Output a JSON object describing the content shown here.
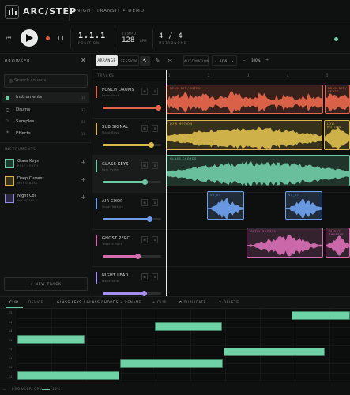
{
  "app": {
    "name": "ARC/STEP",
    "project": "NIGHT TRANSIT • DEMO"
  },
  "transport": {
    "position": "1.1.1",
    "position_label": "POSITION",
    "tempo_label": "TEMPO",
    "tempo": "128",
    "tempo_unit": "BPM",
    "meter": "4 / 4",
    "meter_label": "METRONOME"
  },
  "browser": {
    "title": "BROWSER",
    "search_placeholder": "Search sounds",
    "categories": [
      {
        "label": "Instruments",
        "count": "10",
        "color": "#6ec7a2"
      },
      {
        "label": "Drums",
        "count": "32",
        "color": "#4a4d4c"
      },
      {
        "label": "Samples",
        "count": "88",
        "color": "#4a4d4c"
      },
      {
        "label": "Effects",
        "count": "18",
        "color": "#4a4d4c"
      }
    ],
    "section": "INSTRUMENTS",
    "instruments": [
      {
        "name": "Glass Keys",
        "sub": "POLY SYNTH",
        "color": "#6ec7a2"
      },
      {
        "name": "Deep Current",
        "sub": "MONO BASS",
        "color": "#d6b64a"
      },
      {
        "name": "Night Coil",
        "sub": "WAVETABLE",
        "color": "#8f8be0"
      }
    ],
    "new_track": "+ NEW TRACK"
  },
  "toolbar": {
    "arrange": "ARRANGE",
    "session": "SESSION",
    "automation": "AUTOMATION",
    "grid": "1/16",
    "zoom": "100%"
  },
  "tracks_header": "TRACKS",
  "ruler": [
    "1",
    "2",
    "3",
    "4",
    "5"
  ],
  "tracks": [
    {
      "name": "PUNCH DRUMS",
      "sub": "Drum Rack",
      "color": "#e0654a",
      "volume": 0.95,
      "clips": [
        {
          "label": "NEON KIT / INTRO"
        },
        {
          "label": "NEON KIT / VERSE"
        }
      ]
    },
    {
      "name": "SUB SIGNAL",
      "sub": "Mono Bass",
      "color": "#d8b84c",
      "volume": 0.82,
      "clips": [
        {
          "label": "LOW MOTION"
        },
        {
          "label": "LOW MOTION"
        }
      ]
    },
    {
      "name": "GLASS KEYS",
      "sub": "Poly Synth",
      "color": "#6ec7a2",
      "volume": 0.72,
      "clips": [
        {
          "label": "GLASS CHORDS"
        }
      ]
    },
    {
      "name": "AIR CHOP",
      "sub": "Vocal Texture",
      "color": "#6c9eea",
      "volume": 0.8,
      "clips": [
        {
          "label": "VX_04"
        },
        {
          "label": "VX_07"
        }
      ]
    },
    {
      "name": "GHOST PERC",
      "sub": "Texture Rack",
      "color": "#d36db0",
      "volume": 0.6,
      "clips": [
        {
          "label": "METAL GHOSTS"
        },
        {
          "label": "GHOST SHUFFLE"
        }
      ]
    },
    {
      "name": "NIGHT LEAD",
      "sub": "Wavetable",
      "color": "#a58ef0",
      "volume": 0.7,
      "clips": []
    }
  ],
  "editor": {
    "tabs": [
      "CLIP",
      "DEVICE"
    ],
    "clip_name": "GLASS KEYS / GLASS CHORDS",
    "actions": [
      "+ RENAME",
      "+ CLIP",
      "⧉ DUPLICATE",
      "✕ DELETE"
    ],
    "keys": [
      "C5",
      "B4",
      "A4",
      "G4",
      "F4",
      "E4",
      "D4",
      "C4"
    ],
    "footer": {
      "browser": "BROWSER",
      "cpu_label": "CPU",
      "cpu": "12%"
    }
  },
  "colors": {
    "accent": "#6ec7a2",
    "record": "#e25b3d",
    "background": "#0d0e0e"
  }
}
